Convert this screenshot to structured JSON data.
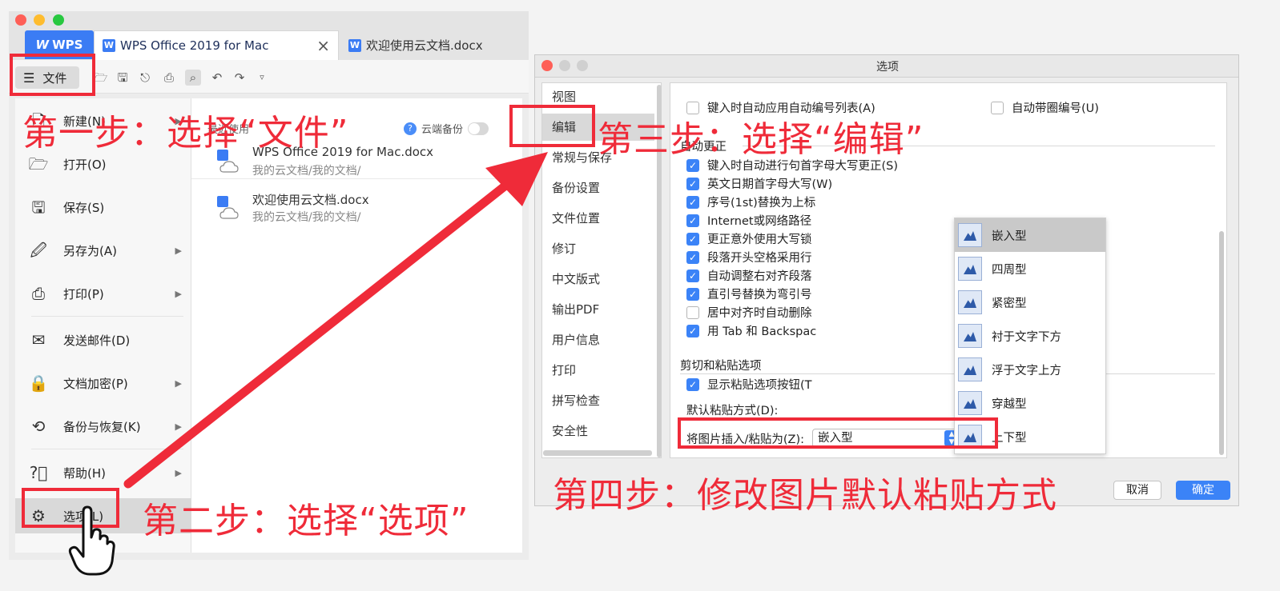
{
  "left_window": {
    "tabs": {
      "wps": "WPS",
      "active": "WPS Office 2019 for Mac",
      "second": "欢迎使用云文档.docx"
    },
    "file_button": "文件",
    "menu": [
      {
        "label": "新建(N)",
        "icon": "new-doc-icon",
        "arrow": true
      },
      {
        "label": "打开(O)",
        "icon": "folder-open-icon",
        "arrow": false
      },
      {
        "label": "保存(S)",
        "icon": "save-icon",
        "arrow": false
      },
      {
        "label": "另存为(A)",
        "icon": "save-as-icon",
        "arrow": true
      },
      {
        "label": "打印(P)",
        "icon": "printer-icon",
        "arrow": true
      },
      {
        "label": "发送邮件(D)",
        "icon": "mail-icon",
        "arrow": false
      },
      {
        "label": "文档加密(P)",
        "icon": "lock-doc-icon",
        "arrow": true
      },
      {
        "label": "备份与恢复(K)",
        "icon": "backup-icon",
        "arrow": true
      },
      {
        "label": "帮助(H)",
        "icon": "help-icon",
        "arrow": true
      },
      {
        "label": "选项(L)",
        "icon": "gear-icon",
        "arrow": false
      }
    ],
    "recent_header": "最近使用",
    "cloud_backup": "云端备份",
    "recent_files": [
      {
        "name": "WPS Office 2019 for Mac.docx",
        "path": "我的云文档/我的文档/"
      },
      {
        "name": "欢迎使用云文档.docx",
        "path": "我的云文档/我的文档/"
      }
    ]
  },
  "dialog": {
    "title": "选项",
    "nav": [
      "视图",
      "编辑",
      "常规与保存",
      "备份设置",
      "文件位置",
      "修订",
      "中文版式",
      "输出PDF",
      "用户信息",
      "打印",
      "拼写检查",
      "安全性"
    ],
    "top_options": [
      {
        "label": "键入时自动应用自动编号列表(A)",
        "checked": false
      },
      {
        "label": "自动带圈编号(U)",
        "checked": false
      }
    ],
    "autocorrect_title": "自动更正",
    "autocorrect": [
      {
        "label": "键入时自动进行句首字母大写更正(S)",
        "checked": true
      },
      {
        "label": "英文日期首字母大写(W)",
        "checked": true
      },
      {
        "label": "序号(1st)替换为上标",
        "checked": true
      },
      {
        "label": "Internet或网络路径",
        "checked": true
      },
      {
        "label": "更正意外使用大写锁",
        "checked": true
      },
      {
        "label": "段落开头空格采用行",
        "checked": true
      },
      {
        "label": "自动调整右对齐段落",
        "checked": true
      },
      {
        "label": "直引号替换为弯引号",
        "checked": true
      },
      {
        "label": "居中对齐时自动删除",
        "checked": false
      },
      {
        "label": "用 Tab 和 Backspac",
        "checked": true
      }
    ],
    "paste_title": "剪切和粘贴选项",
    "paste_show_button": {
      "label": "显示粘贴选项按钮(T",
      "checked": true
    },
    "default_paste_label": "默认粘贴方式(D):",
    "insert_label": "将图片插入/粘贴为(Z):",
    "insert_value": "嵌入型",
    "dropdown": [
      "嵌入型",
      "四周型",
      "紧密型",
      "衬于文字下方",
      "浮于文字上方",
      "穿越型",
      "上下型"
    ],
    "cancel": "取消",
    "ok": "确定"
  },
  "annotations": {
    "step1": "第一步：选择“文件”",
    "step2": "第二步：选择“选项”",
    "step3": "第三步：选择“编辑”",
    "step4": "第四步：修改图片默认粘贴方式"
  },
  "colors": {
    "annotation_red": "#ef2b39",
    "accent_blue": "#3b83f7"
  }
}
